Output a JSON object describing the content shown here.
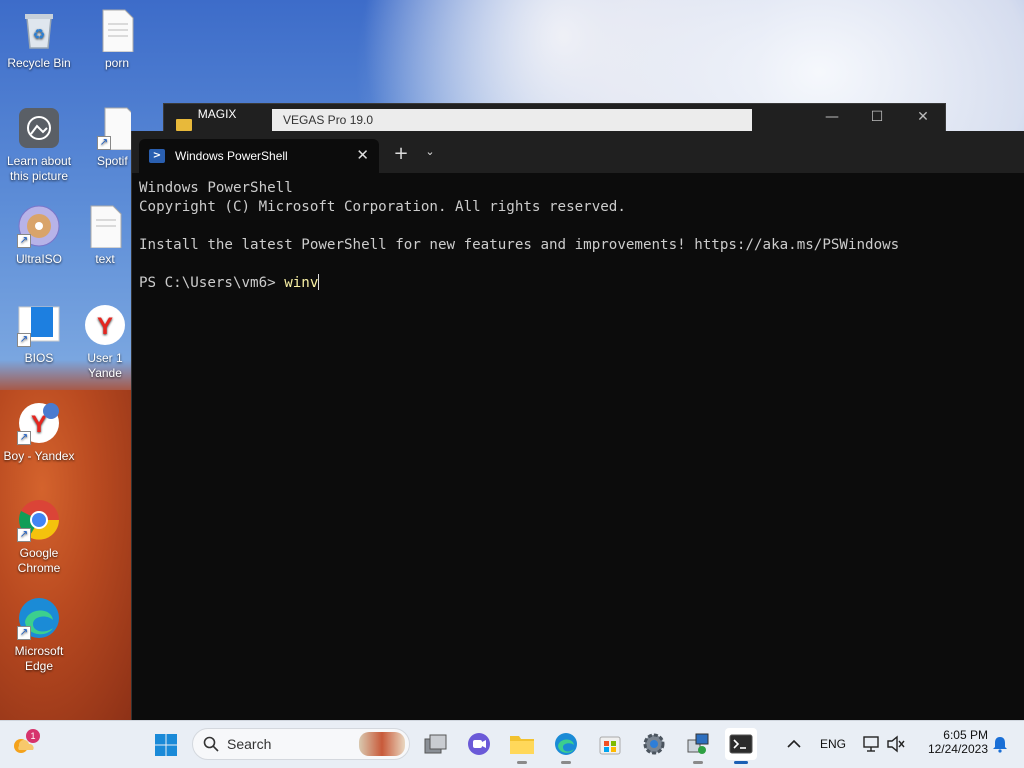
{
  "desktop": {
    "icons": [
      {
        "label": "Recycle Bin"
      },
      {
        "label": "porn"
      },
      {
        "label": "Learn about this picture"
      },
      {
        "label": "Spotif"
      },
      {
        "label": "UltraISO"
      },
      {
        "label": "text"
      },
      {
        "label": "BIOS"
      },
      {
        "label": "User 1 Yande"
      },
      {
        "label": "Boy - Yandex"
      },
      {
        "label": "Google Chrome"
      },
      {
        "label": "Microsoft Edge"
      }
    ]
  },
  "background_window": {
    "tab1": "MAGIX VEGA",
    "tab2": "VEGAS Pro 19.0",
    "minimize": "—",
    "maximize": "☐",
    "close": "✕"
  },
  "terminal": {
    "tab_title": "Windows PowerShell",
    "tab_close": "✕",
    "new_tab": "+",
    "dropdown": "⌄",
    "lines": [
      "Windows PowerShell",
      "Copyright (C) Microsoft Corporation. All rights reserved.",
      "",
      "Install the latest PowerShell for new features and improvements! https://aka.ms/PSWindows",
      ""
    ],
    "prompt": "PS C:\\Users\\vm6> ",
    "command": "winv"
  },
  "taskbar": {
    "search_label": "Search",
    "widget_badge": "1",
    "language": "ENG",
    "time": "6:05 PM",
    "date": "12/24/2023"
  },
  "colors": {
    "terminal_bg": "#0c0c0c",
    "terminal_text": "#cccccc",
    "command_text": "#f9f1a5",
    "taskbar_bg": "#e9eef5",
    "accent": "#1a5fb4"
  }
}
